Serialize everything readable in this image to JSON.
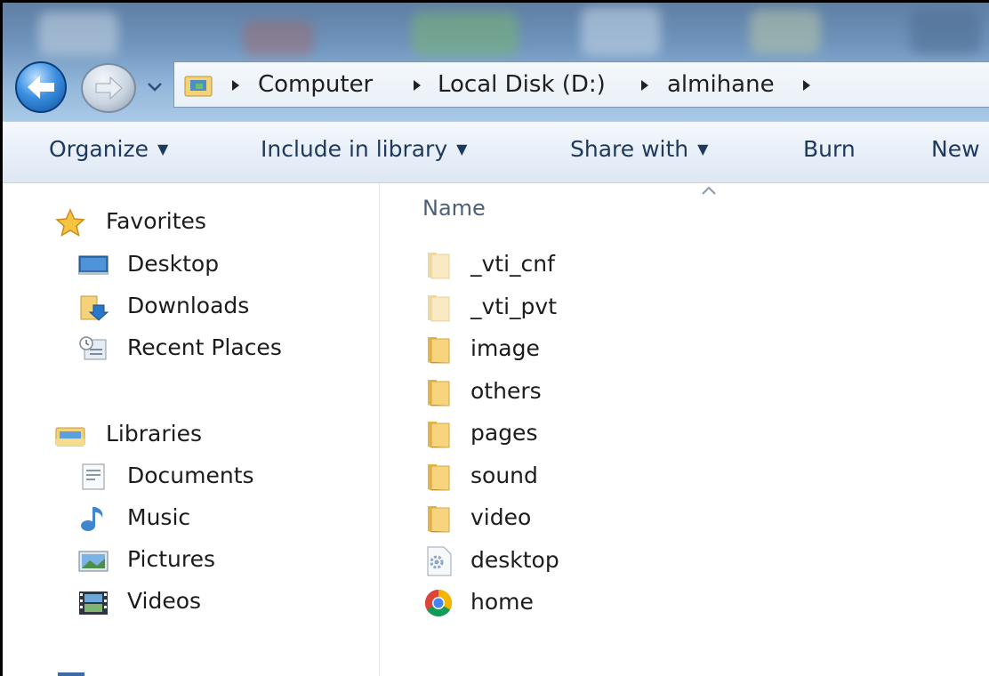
{
  "breadcrumb": {
    "items": [
      "Computer",
      "Local Disk (D:)",
      "almihane"
    ]
  },
  "toolbar": {
    "organize": "Organize",
    "include_in_library": "Include in library",
    "share_with": "Share with",
    "burn": "Burn",
    "new_folder": "New"
  },
  "sidebar": {
    "favorites": {
      "title": "Favorites",
      "items": [
        "Desktop",
        "Downloads",
        "Recent Places"
      ]
    },
    "libraries": {
      "title": "Libraries",
      "items": [
        "Documents",
        "Music",
        "Pictures",
        "Videos"
      ]
    }
  },
  "content": {
    "column_header": "Name",
    "files": [
      {
        "name": "_vti_cnf",
        "icon": "folder-faded-icon"
      },
      {
        "name": "_vti_pvt",
        "icon": "folder-faded-icon"
      },
      {
        "name": "image",
        "icon": "folder-icon"
      },
      {
        "name": "others",
        "icon": "folder-icon"
      },
      {
        "name": "pages",
        "icon": "folder-icon"
      },
      {
        "name": "sound",
        "icon": "folder-icon"
      },
      {
        "name": "video",
        "icon": "folder-icon"
      },
      {
        "name": "desktop",
        "icon": "settings-file-icon"
      },
      {
        "name": "home",
        "icon": "chrome-icon"
      }
    ]
  },
  "colors": {
    "toolbar_text": "#1e395b",
    "folder": "#f3d27a"
  }
}
